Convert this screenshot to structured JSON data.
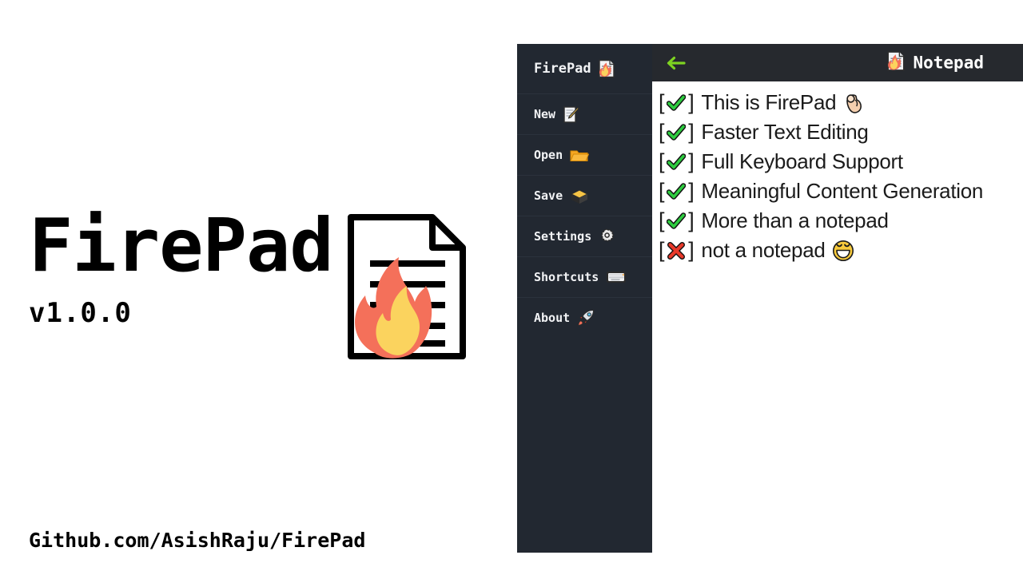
{
  "brand": {
    "title": "FirePad",
    "version": "v1.0.0",
    "footer_link": "Github.com/AsishRaju/FirePad",
    "logo_icon": "firepad-document-flame-logo"
  },
  "sidebar": {
    "header": {
      "label": "FirePad",
      "icon": "firepad-document-flame-icon"
    },
    "items": [
      {
        "label": "New",
        "icon": "memo-pencil-icon"
      },
      {
        "label": "Open",
        "icon": "open-folder-icon"
      },
      {
        "label": "Save",
        "icon": "card-file-box-icon"
      },
      {
        "label": "Settings",
        "icon": "gear-icon"
      },
      {
        "label": "Shortcuts",
        "icon": "keyboard-icon"
      },
      {
        "label": "About",
        "icon": "rocket-icon"
      }
    ]
  },
  "notepad": {
    "back_icon": "back-arrow-icon",
    "title": "Notepad",
    "title_icon": "firepad-document-flame-icon",
    "lines": [
      {
        "checked": true,
        "text": "This is FirePad",
        "emoji": "ok-hand-emoji"
      },
      {
        "checked": true,
        "text": "Faster Text Editing",
        "emoji": ""
      },
      {
        "checked": true,
        "text": "Full Keyboard Support",
        "emoji": ""
      },
      {
        "checked": true,
        "text": "Meaningful Content Generation",
        "emoji": ""
      },
      {
        "checked": true,
        "text": "More than a notepad",
        "emoji": ""
      },
      {
        "checked": false,
        "text": "not a notepad",
        "emoji": "grinning-face-smiling-eyes-emoji"
      }
    ],
    "open_bracket": "[",
    "close_bracket": "]"
  },
  "colors": {
    "sidebar_bg": "#222831",
    "header_bg": "#26292e",
    "accent_green": "#7ed321",
    "check_green": "#21c52e",
    "cross_red": "#e8392a",
    "page_bg": "#ffffff",
    "text_dark": "#1b1b1b"
  }
}
